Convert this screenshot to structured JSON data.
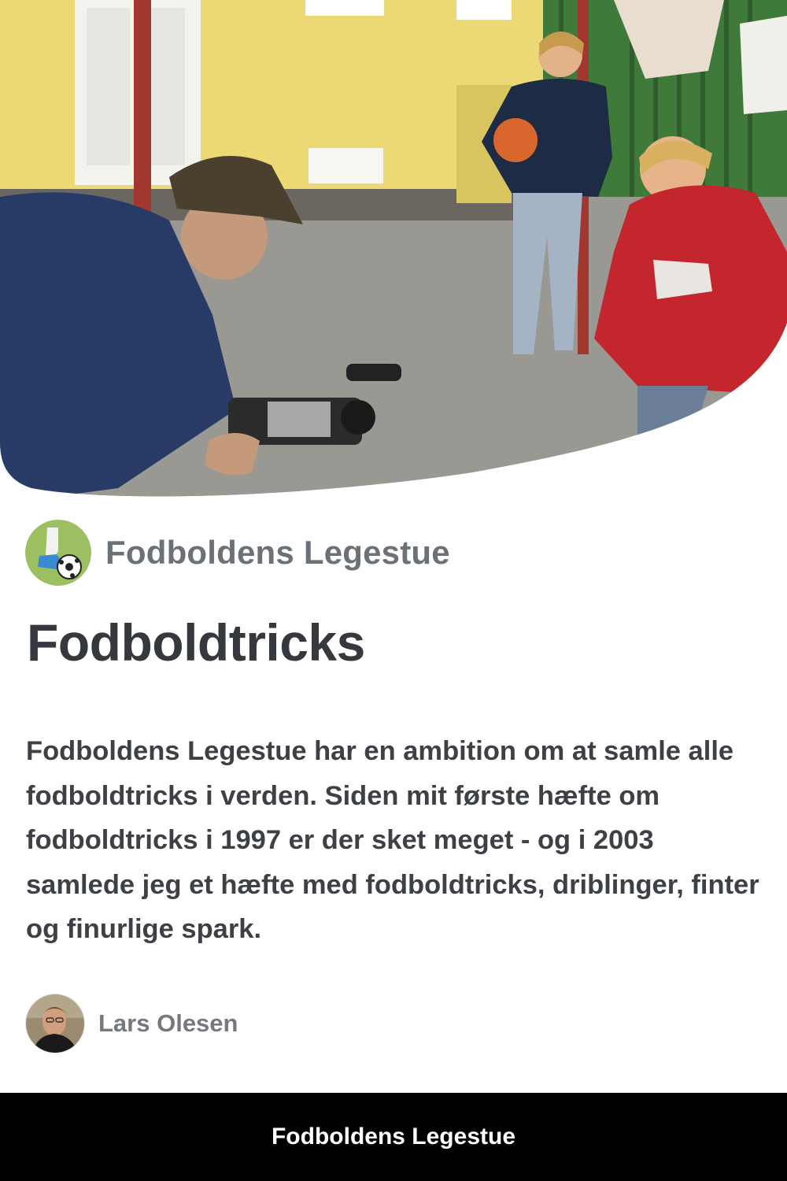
{
  "hero": {
    "image_name": "photo-filming-football-tricks"
  },
  "site": {
    "name": "Fodboldens Legestue",
    "logo_icon": "football-kick-icon"
  },
  "article": {
    "title": "Fodboldtricks",
    "description": "Fodboldens Legestue har en ambition om at samle alle fodboldtricks i verden. Siden mit første hæfte om fodboldtricks i 1997 er der sket meget - og i 2003 samlede jeg et hæfte med fodboldtricks, driblinger, finter og finurlige spark."
  },
  "author": {
    "name": "Lars Olesen",
    "avatar_icon": "author-avatar"
  },
  "footer": {
    "label": "Fodboldens Legestue"
  },
  "colors": {
    "footer_bg": "#000000",
    "title": "#35383c",
    "muted": "#6b7177",
    "logo_bg": "#9cbf62"
  }
}
